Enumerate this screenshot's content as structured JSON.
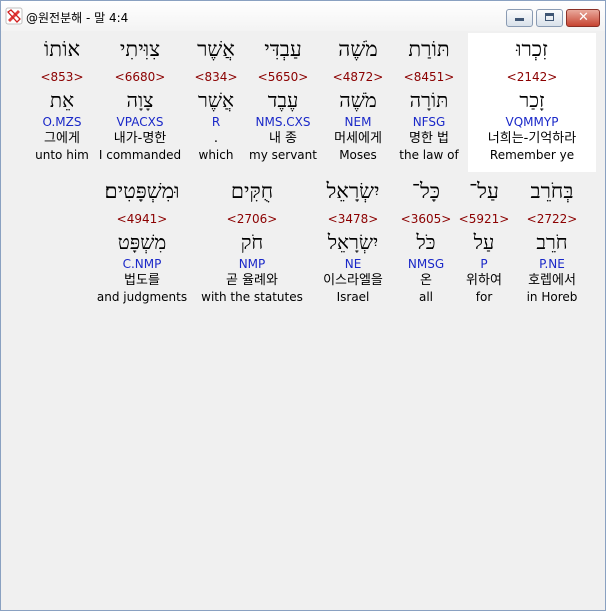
{
  "window": {
    "title": "@원전분해 - 말 4:4"
  },
  "row1": [
    {
      "heb": "זִכְרוּ",
      "num": "<2142>",
      "root": "זָכַר",
      "parse": "VQMMYP",
      "ko": "너희는-기억하라",
      "en": "Remember ye"
    },
    {
      "heb": "תּוֹרַת",
      "num": "<8451>",
      "root": "תּוֹרָה",
      "parse": "NFSG",
      "ko": "명한 법",
      "en": "the law of"
    },
    {
      "heb": "מֹשֶׁה",
      "num": "<4872>",
      "root": "מֹשֶׁה",
      "parse": "NEM",
      "ko": "머세에게",
      "en": "Moses"
    },
    {
      "heb": "עַבְדִּי",
      "num": "<5650>",
      "root": "עֶבֶד",
      "parse": "NMS.CXS",
      "ko": "내 종",
      "en": "my servant"
    },
    {
      "heb": "אֲשֶׁר",
      "num": "<834>",
      "root": "אֲשֶׁר",
      "parse": "R",
      "ko": ".",
      "en": "which"
    },
    {
      "heb": "צִוִּיתִי",
      "num": "<6680>",
      "root": "צָוָה",
      "parse": "VPACXS",
      "ko": "내가-명한",
      "en": "I commanded"
    },
    {
      "heb": "אוֹתוֹ",
      "num": "<853>",
      "root": "אֵת",
      "parse": "O.MZS",
      "ko": "그에게",
      "en": "unto him"
    }
  ],
  "row2": [
    {
      "heb": "בְּחֹרֵב",
      "num": "<2722>",
      "root": "חֹרֵב",
      "parse": "P.NE",
      "ko": "호렙에서",
      "en": "in Horeb"
    },
    {
      "heb": "עַל־",
      "num": "<5921>",
      "root": "עַל",
      "parse": "P",
      "ko": "위하여",
      "en": "for"
    },
    {
      "heb": "כָּל־",
      "num": "<3605>",
      "root": "כֹּל",
      "parse": "NMSG",
      "ko": "온",
      "en": "all"
    },
    {
      "heb": "יִשְׂרָאֵל",
      "num": "<3478>",
      "root": "יִשְׂרָאֵל",
      "parse": "NE",
      "ko": "이스라엘을",
      "en": "Israel"
    },
    {
      "heb": "חֻקִּים",
      "num": "<2706>",
      "root": "חֹק",
      "parse": "NMP",
      "ko": "곧 율례와",
      "en": "with the statutes"
    },
    {
      "heb": "וּמִשְׁפָּטִים׃",
      "num": "<4941>",
      "root": "מִשְׁפָּט",
      "parse": "C.NMP",
      "ko": "법도를",
      "en": "and judgments"
    }
  ]
}
